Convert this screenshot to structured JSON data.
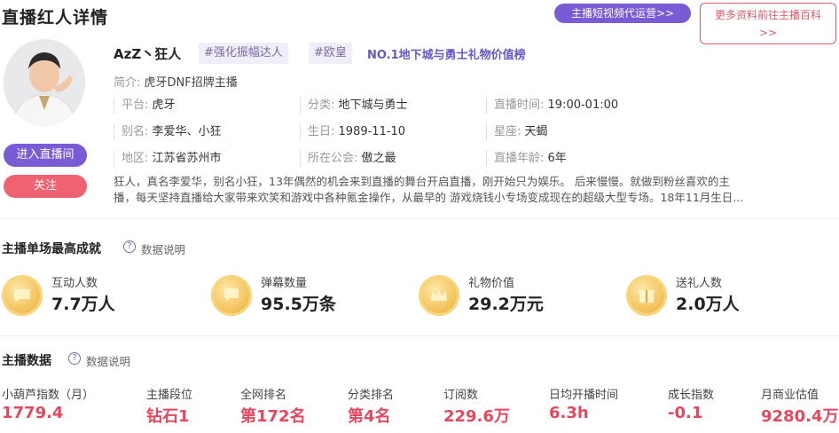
{
  "header": {
    "title": "直播红人详情",
    "promo_button": "主播短视频代运营>>",
    "more_button_line1": "更多资料前往主播百科",
    "more_button_line2": ">>"
  },
  "profile": {
    "name": "AzZ丶狂人",
    "tags": [
      "#强化振幅达人",
      "#欧皇"
    ],
    "rank_link": "NO.1地下城与勇士礼物价值榜",
    "intro_label": "简介:",
    "intro_value": "虎牙DNF招牌主播",
    "info": [
      {
        "label": "平台:",
        "value": "虎牙"
      },
      {
        "label": "分类:",
        "value": "地下城与勇士"
      },
      {
        "label": "直播时间:",
        "value": "19:00-01:00"
      },
      {
        "label": "别名:",
        "value": "李爱华、小狂"
      },
      {
        "label": "生日:",
        "value": "1989-11-10"
      },
      {
        "label": "星座:",
        "value": "天蝎"
      },
      {
        "label": "地区:",
        "value": "江苏省苏州市"
      },
      {
        "label": "所在公会:",
        "value": "傲之最"
      },
      {
        "label": "直播年龄:",
        "value": "6年"
      }
    ],
    "enter_button": "进入直播间",
    "follow_button": "关注",
    "description_line1": "狂人，真名李爱华，别名小狂，13年偶然的机会来到直播的舞台开启直播，刚开始只为娱乐。 后来慢慢。就做到粉丝喜欢的主",
    "description_line2": "播，每天坚持直播给大家带来欢笑和游戏中各种氪金操作，从最早的 游戏烧钱小专场变成现在的超级大型专场。18年11月生日..."
  },
  "best_session": {
    "title": "主播单场最高成就",
    "help": "数据说明",
    "stats": [
      {
        "label": "互动人数",
        "value": "7.7万人",
        "icon": "chat-coin-icon"
      },
      {
        "label": "弹幕数量",
        "value": "95.5万条",
        "icon": "barrage-coin-icon"
      },
      {
        "label": "礼物价值",
        "value": "29.2万元",
        "icon": "crown-coin-icon"
      },
      {
        "label": "送礼人数",
        "value": "2.0万人",
        "icon": "gift-coin-icon"
      }
    ]
  },
  "anchor_data": {
    "title": "主播数据",
    "help": "数据说明",
    "items": [
      {
        "label": "小葫芦指数（月）",
        "value": "1779.4"
      },
      {
        "label": "主播段位",
        "value": "钻石1"
      },
      {
        "label": "全网排名",
        "value": "第172名"
      },
      {
        "label": "分类排名",
        "value": "第4名"
      },
      {
        "label": "订阅数",
        "value": "229.6万"
      },
      {
        "label": "日均开播时间",
        "value": "6.3h"
      },
      {
        "label": "成长指数",
        "value": "-0.1"
      },
      {
        "label": "月商业估值",
        "value": "9280.4万"
      }
    ]
  },
  "colors": {
    "accent": "#7a5bd6",
    "red": "#e8475d",
    "follow": "#f06271",
    "gold": "#f4c560"
  }
}
